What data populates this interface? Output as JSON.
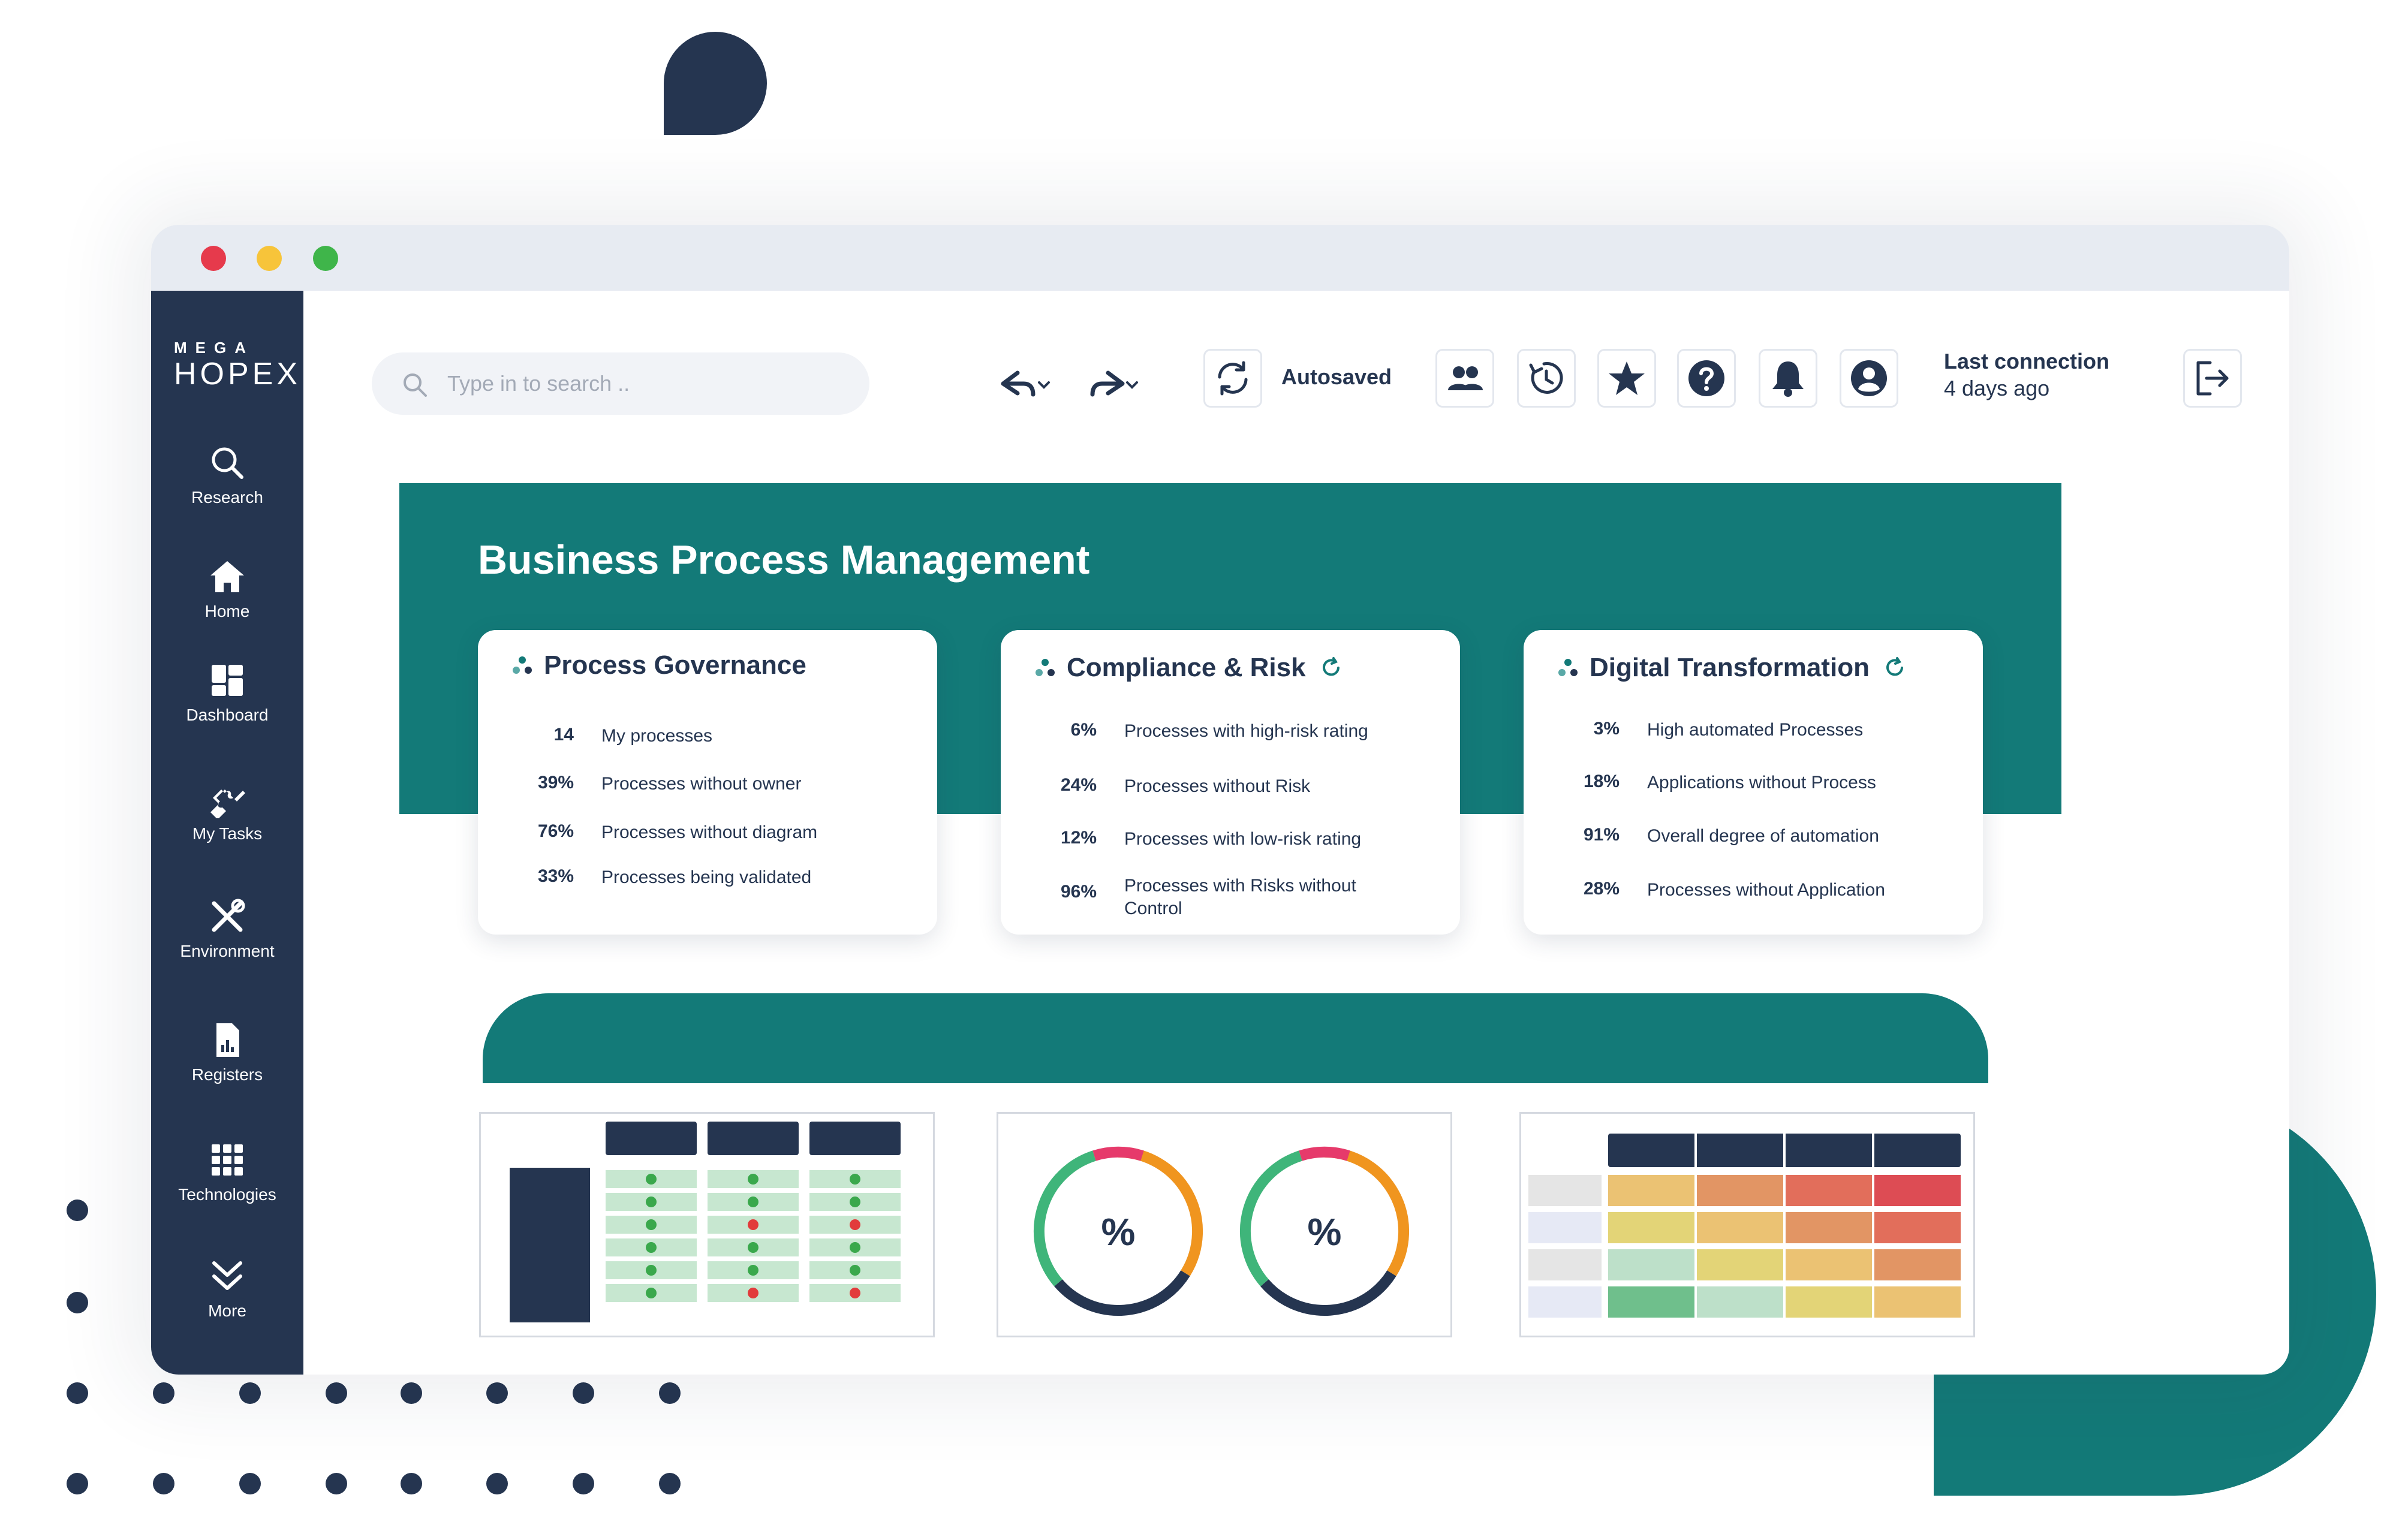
{
  "brand": {
    "top": "MEGA",
    "main": "HOPEX"
  },
  "sidebar": {
    "items": [
      {
        "label": "Research",
        "icon": "search-icon"
      },
      {
        "label": "Home",
        "icon": "home-icon"
      },
      {
        "label": "Dashboard",
        "icon": "dashboard-icon"
      },
      {
        "label": "My Tasks",
        "icon": "puzzle-icon"
      },
      {
        "label": "Environment",
        "icon": "tools-icon"
      },
      {
        "label": "Registers",
        "icon": "report-icon"
      },
      {
        "label": "Technologies",
        "icon": "grid-icon"
      },
      {
        "label": "More",
        "icon": "chevrons-down-icon"
      }
    ]
  },
  "toolbar": {
    "search_placeholder": "Type in to search ..",
    "autosaved": "Autosaved",
    "last_connection_title": "Last connection",
    "last_connection_value": "4 days ago"
  },
  "hero": {
    "title": "Business Process Management"
  },
  "cards": [
    {
      "title": "Process Governance",
      "rows": [
        {
          "value": "14",
          "label": "My processes"
        },
        {
          "value": "39%",
          "label": "Processes without owner"
        },
        {
          "value": "76%",
          "label": "Processes without diagram"
        },
        {
          "value": "33%",
          "label": "Processes being validated"
        }
      ]
    },
    {
      "title": "Compliance & Risk",
      "rows": [
        {
          "value": "6%",
          "label": "Processes with high-risk rating"
        },
        {
          "value": "24%",
          "label": "Processes without Risk"
        },
        {
          "value": "12%",
          "label": "Processes with low-risk rating"
        },
        {
          "value": "96%",
          "label": "Processes with Risks without Control"
        }
      ]
    },
    {
      "title": "Digital Transformation",
      "rows": [
        {
          "value": "3%",
          "label": "High automated Processes"
        },
        {
          "value": "18%",
          "label": "Applications without Process"
        },
        {
          "value": "91%",
          "label": "Overall degree of automation"
        },
        {
          "value": "28%",
          "label": "Processes without Application"
        }
      ]
    }
  ],
  "widgets": {
    "donut_symbol": "%",
    "matrix_marks": [
      [
        "ok",
        "ok",
        "ok"
      ],
      [
        "ok",
        "ok",
        "ok"
      ],
      [
        "ok",
        "x",
        "x"
      ],
      [
        "ok",
        "ok",
        "ok"
      ],
      [
        "ok",
        "ok",
        "ok"
      ],
      [
        "ok",
        "x",
        "x"
      ]
    ],
    "heatmap_colors": [
      [
        "#e5e5e5",
        "#ebc273",
        "#e29564",
        "#e26e5b",
        "#dd4c54"
      ],
      [
        "#e6e9f5",
        "#e3d477",
        "#ebc273",
        "#e29564",
        "#e26e5b"
      ],
      [
        "#e5e5e5",
        "#bde0c9",
        "#e3d477",
        "#ebc273",
        "#e29564"
      ],
      [
        "#e6e9f5",
        "#6fbf8c",
        "#bde0c9",
        "#e3d477",
        "#ebc273"
      ]
    ]
  },
  "colors": {
    "navy": "#253550",
    "teal": "#137a78",
    "ring_green": "#3fb57a",
    "ring_orange": "#f0951f",
    "ring_pink": "#e63a6b"
  }
}
